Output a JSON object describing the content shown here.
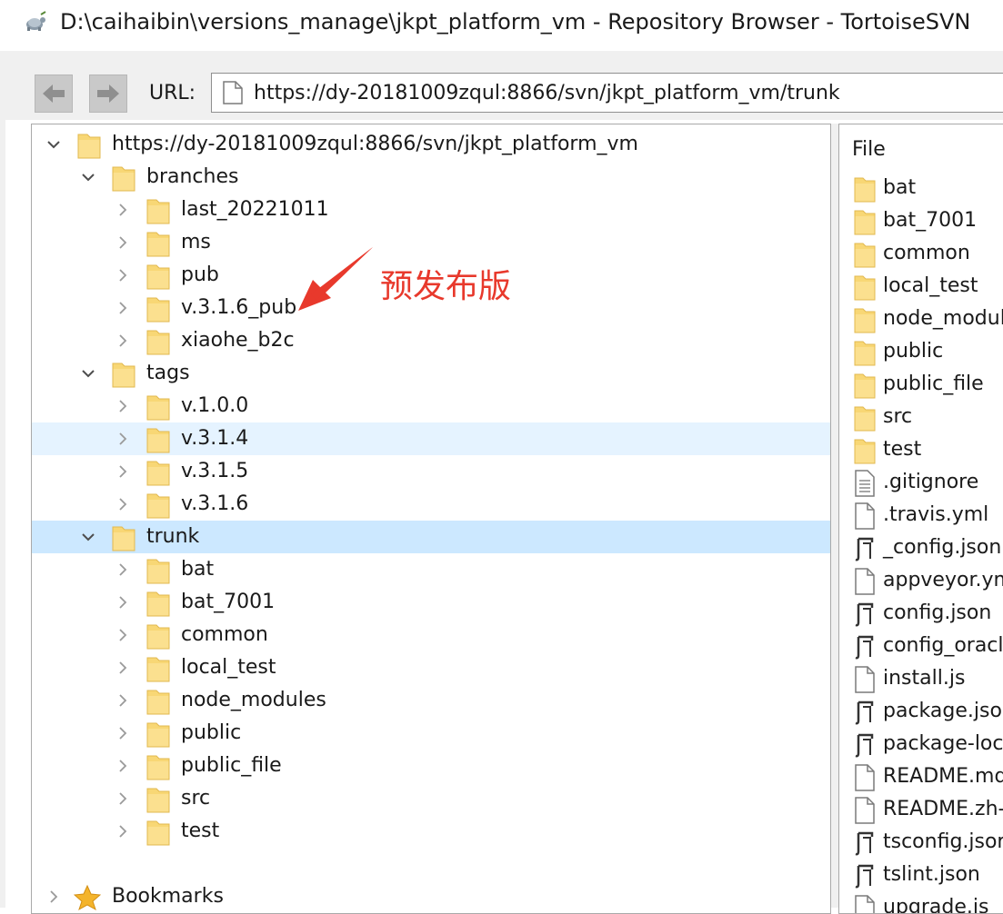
{
  "window": {
    "title": "D:\\caihaibin\\versions_manage\\jkpt_platform_vm - Repository Browser - TortoiseSVN"
  },
  "toolbar": {
    "url_label": "URL:",
    "url_value": "https://dy-20181009zqul:8866/svn/jkpt_platform_vm/trunk"
  },
  "tree": {
    "rows": [
      {
        "label": "https://dy-20181009zqul:8866/svn/jkpt_platform_vm",
        "expanded": true
      },
      {
        "label": "branches",
        "expanded": true
      },
      {
        "label": "last_20221011",
        "expanded": false
      },
      {
        "label": "ms",
        "expanded": false
      },
      {
        "label": "pub",
        "expanded": false
      },
      {
        "label": "v.3.1.6_pub",
        "expanded": false
      },
      {
        "label": "xiaohe_b2c",
        "expanded": false
      },
      {
        "label": "tags",
        "expanded": true
      },
      {
        "label": "v.1.0.0",
        "expanded": false
      },
      {
        "label": "v.3.1.4",
        "expanded": false,
        "state": "hover"
      },
      {
        "label": "v.3.1.5",
        "expanded": false
      },
      {
        "label": "v.3.1.6",
        "expanded": false
      },
      {
        "label": "trunk",
        "expanded": true,
        "state": "selected"
      },
      {
        "label": "bat",
        "expanded": false
      },
      {
        "label": "bat_7001",
        "expanded": false
      },
      {
        "label": "common",
        "expanded": false
      },
      {
        "label": "local_test",
        "expanded": false
      },
      {
        "label": "node_modules",
        "expanded": false
      },
      {
        "label": "public",
        "expanded": false
      },
      {
        "label": "public_file",
        "expanded": false
      },
      {
        "label": "src",
        "expanded": false
      },
      {
        "label": "test",
        "expanded": false
      }
    ],
    "bookmarks_label": "Bookmarks"
  },
  "files": {
    "header": "File",
    "rows": [
      {
        "name": "bat",
        "icon": "folder-icon"
      },
      {
        "name": "bat_7001",
        "icon": "folder-icon"
      },
      {
        "name": "common",
        "icon": "folder-icon"
      },
      {
        "name": "local_test",
        "icon": "folder-icon"
      },
      {
        "name": "node_modul",
        "icon": "folder-icon"
      },
      {
        "name": "public",
        "icon": "folder-icon"
      },
      {
        "name": "public_file",
        "icon": "folder-icon"
      },
      {
        "name": "src",
        "icon": "folder-icon"
      },
      {
        "name": "test",
        "icon": "folder-icon"
      },
      {
        "name": ".gitignore",
        "icon": "text-file-icon"
      },
      {
        "name": ".travis.yml",
        "icon": "file-icon"
      },
      {
        "name": "_config.json",
        "icon": "json-file-icon"
      },
      {
        "name": "appveyor.ym",
        "icon": "file-icon"
      },
      {
        "name": "config.json",
        "icon": "json-file-icon"
      },
      {
        "name": "config_oracl",
        "icon": "json-file-icon"
      },
      {
        "name": "install.js",
        "icon": "file-icon"
      },
      {
        "name": "package.jsor",
        "icon": "json-file-icon"
      },
      {
        "name": "package-lock",
        "icon": "json-file-icon"
      },
      {
        "name": "README.md",
        "icon": "file-icon"
      },
      {
        "name": "README.zh-",
        "icon": "file-icon"
      },
      {
        "name": "tsconfig.jsor",
        "icon": "json-file-icon"
      },
      {
        "name": "tslint.json",
        "icon": "json-file-icon"
      },
      {
        "name": "upgrade.js",
        "icon": "file-icon"
      }
    ]
  },
  "annotation": {
    "text": "预发布版",
    "color": "#e8392c"
  },
  "colors": {
    "folder": "#f8d775",
    "selected_row": "#cce8ff",
    "hover_row": "#e5f3ff"
  }
}
